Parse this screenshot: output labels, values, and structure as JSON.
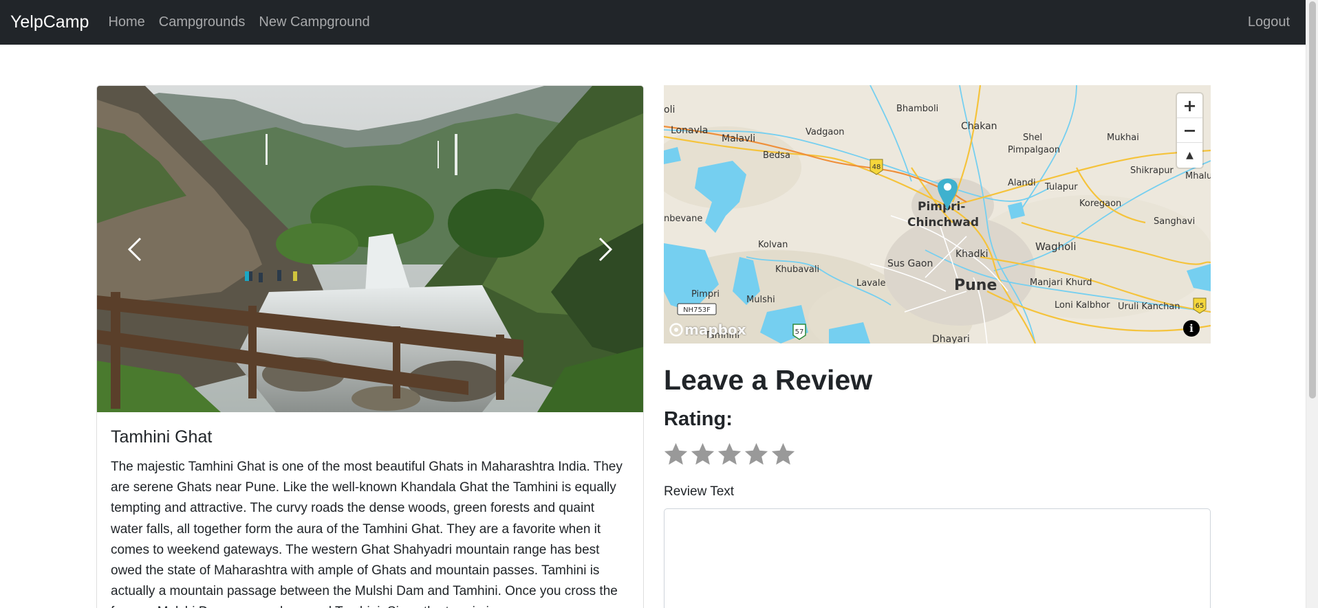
{
  "navbar": {
    "brand": "YelpCamp",
    "links": [
      "Home",
      "Campgrounds",
      "New Campground"
    ],
    "logout": "Logout"
  },
  "campground": {
    "title": "Tamhini Ghat",
    "description": "The majestic Tamhini Ghat is one of the most beautiful Ghats in Maharashtra India. They are serene Ghats near Pune. Like the well-known Khandala Ghat the Tamhini is equally tempting and attractive. The curvy roads the dense woods, green forests and quaint water falls, all together form the aura of the Tamhini Ghat. They are a favorite when it comes to weekend gateways. The western Ghat Shahyadri mountain range has best owed the state of Maharashtra with ample of Ghats and mountain passes. Tamhini is actually a mountain passage between the Mulshi Dam and Tamhini. Once you cross the famous Mulshi Dam you reach around Tamhini. Since the terrain is"
  },
  "map": {
    "places": [
      "Lonavla",
      "Malavli",
      "Vadgaon",
      "Bedsa",
      "Bhamboli",
      "Chakan",
      "Shel",
      "Mukhai",
      "Pimpalgaon",
      "Shikrapur",
      "Mhalu",
      "Alandi",
      "Tulapur",
      "Koregaon",
      "Sanghavi",
      "Pimpri-",
      "Chinchwad",
      "Khadki",
      "Wagholi",
      "Sus Gaon",
      "Pune",
      "Manjari Khurd",
      "Loni Kalbhor",
      "Uruli Kanchan",
      "Kolvan",
      "Khubavali",
      "Lavale",
      "Pimpri",
      "Mulshi",
      "Tamhini",
      "Dhayari",
      "nbevane",
      "oli"
    ],
    "highway_labels": [
      "48",
      "65",
      "57",
      "NH753F"
    ],
    "zoom_in": "+",
    "zoom_out": "−",
    "compass": "▲",
    "attribution": "i",
    "logo": "mapbox"
  },
  "review": {
    "heading": "Leave a Review",
    "rating_label": "Rating:",
    "stars": 5,
    "text_label": "Review Text"
  },
  "colors": {
    "navbar": "#212529",
    "nav_link": "rgba(255,255,255,0.6)",
    "star": "#999999",
    "marker": "#3fb1ce",
    "water": "#75cff0"
  }
}
